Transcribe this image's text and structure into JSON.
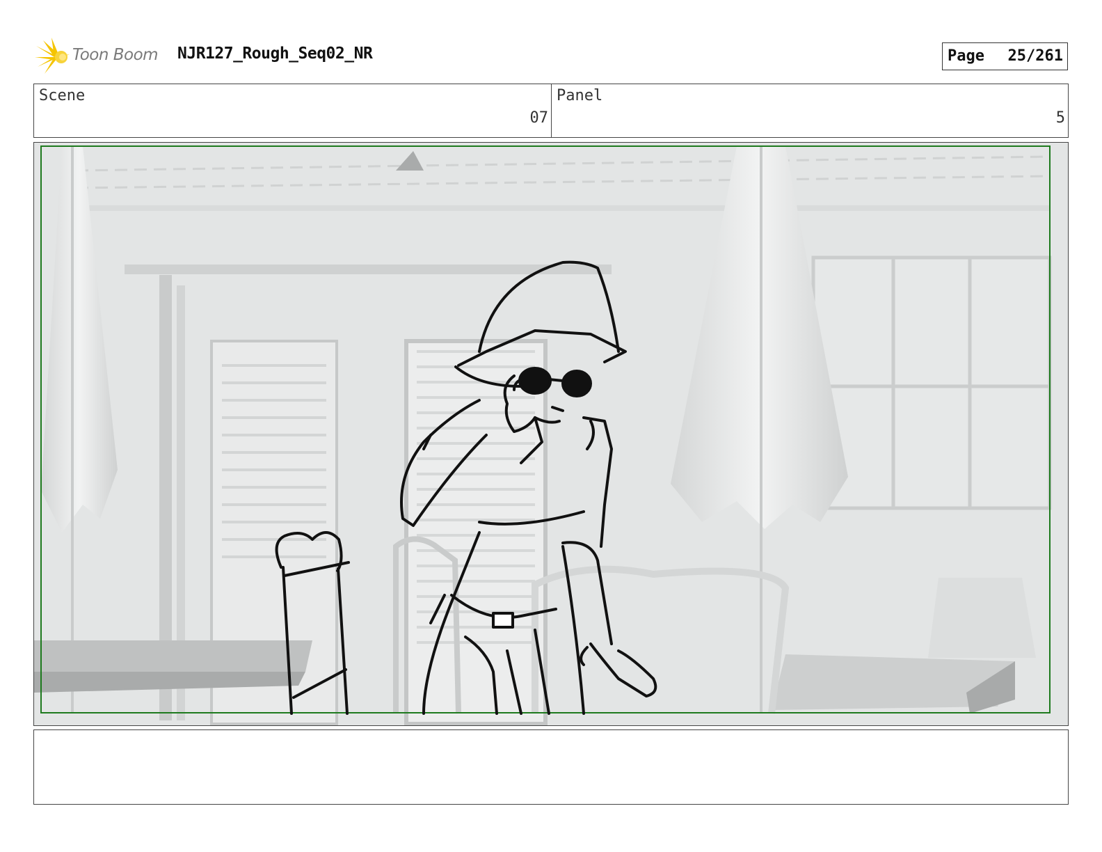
{
  "header": {
    "logo_text": "Toon Boom",
    "title": "NJR127_Rough_Seq02_NR",
    "page_label": "Page",
    "page_value": "25/261"
  },
  "info": {
    "scene_label": "Scene",
    "scene_value": "07",
    "panel_label": "Panel",
    "panel_value": "5"
  },
  "notes": {
    "text": ""
  },
  "icons": {
    "logo": "toon-boom-star-logo"
  },
  "colors": {
    "safe_area_border": "#1e7a1e",
    "logo_star": "#f5c400",
    "background_render": "#e4e6e6"
  }
}
